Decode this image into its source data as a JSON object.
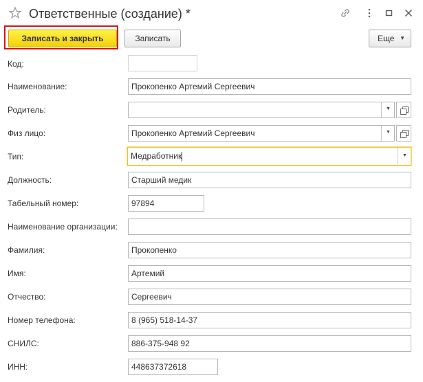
{
  "window": {
    "title": "Ответственные (создание) *",
    "icons": [
      "star-icon",
      "link-icon",
      "more-vertical-icon",
      "maximize-icon",
      "close-icon"
    ]
  },
  "toolbar": {
    "save_close_label": "Записать и закрыть",
    "save_label": "Записать",
    "more_label": "Еще"
  },
  "form": {
    "code": {
      "label": "Код:",
      "value": ""
    },
    "name": {
      "label": "Наименование:",
      "value": "Прокопенко Артемий Сергеевич"
    },
    "parent": {
      "label": "Родитель:",
      "value": ""
    },
    "person": {
      "label": "Физ лицо:",
      "value": "Прокопенко Артемий Сергеевич"
    },
    "type": {
      "label": "Тип:",
      "value": "Медработник"
    },
    "position": {
      "label": "Должность:",
      "value": "Старший медик"
    },
    "employee_number": {
      "label": "Табельный номер:",
      "value": "97894"
    },
    "organization": {
      "label": "Наименование организации:",
      "value": ""
    },
    "last_name": {
      "label": "Фамилия:",
      "value": "Прокопенко"
    },
    "first_name": {
      "label": "Имя:",
      "value": "Артемий"
    },
    "patronymic": {
      "label": "Отчество:",
      "value": "Сергеевич"
    },
    "phone": {
      "label": "Номер телефона:",
      "value": "8 (965) 518-14-37"
    },
    "snils": {
      "label": "СНИЛС:",
      "value": "886-375-948 92"
    },
    "inn": {
      "label": "ИНН:",
      "value": "448637372618"
    }
  },
  "colors": {
    "primary_button": "#f6dc1e",
    "highlight_frame": "#d9121a",
    "focus_border": "#f0c233"
  }
}
